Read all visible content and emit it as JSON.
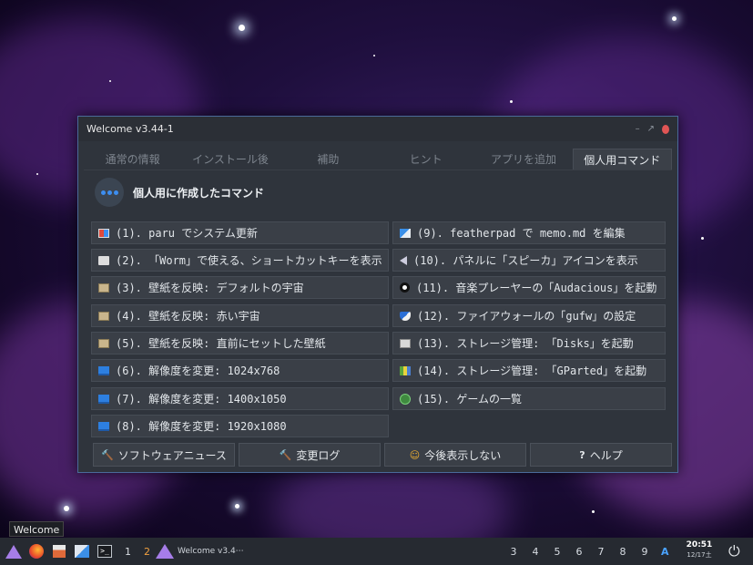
{
  "window": {
    "title": "Welcome v3.44-1",
    "controls": {
      "minimize": "–",
      "maximize": "↗"
    }
  },
  "tabs": [
    {
      "label": "通常の情報"
    },
    {
      "label": "インストール後"
    },
    {
      "label": "補助"
    },
    {
      "label": "ヒント"
    },
    {
      "label": "アプリを追加"
    },
    {
      "label": "個人用コマンド",
      "active": true
    }
  ],
  "header": {
    "title": "個人用に作成したコマンド",
    "icon": "dots-icon"
  },
  "commands_left": [
    {
      "label": "(1). paru でシステム更新",
      "icon": "grid-icon"
    },
    {
      "label": "(2). 「Worm」で使える、ショートカットキーを表示",
      "icon": "keyboard-icon"
    },
    {
      "label": "(3). 壁紙を反映: デフォルトの宇宙",
      "icon": "wallpaper-icon"
    },
    {
      "label": "(4). 壁紙を反映: 赤い宇宙",
      "icon": "wallpaper-icon"
    },
    {
      "label": "(5). 壁紙を反映: 直前にセットした壁紙",
      "icon": "wallpaper-icon"
    },
    {
      "label": "(6). 解像度を変更: 1024x768",
      "icon": "monitor-icon"
    },
    {
      "label": "(7). 解像度を変更: 1400x1050",
      "icon": "monitor-icon"
    },
    {
      "label": "(8). 解像度を変更: 1920x1080",
      "icon": "monitor-icon"
    }
  ],
  "commands_right": [
    {
      "label": "(9). featherpad で memo.md を編集",
      "icon": "edit-icon"
    },
    {
      "label": "(10). パネルに「スピーカ」アイコンを表示",
      "icon": "speaker-icon"
    },
    {
      "label": "(11). 音楽プレーヤーの「Audacious」を起動",
      "icon": "audio-icon"
    },
    {
      "label": "(12). ファイアウォールの「gufw」の設定",
      "icon": "shield-icon"
    },
    {
      "label": "(13). ストレージ管理: 「Disks」を起動",
      "icon": "disk-icon"
    },
    {
      "label": "(14). ストレージ管理: 「GParted」を起動",
      "icon": "gparted-icon"
    },
    {
      "label": "(15). ゲームの一覧",
      "icon": "game-icon"
    }
  ],
  "bottom_buttons": [
    {
      "label": "ソフトウェアニュース",
      "icon": "hammer-icon",
      "glyph": "🔨"
    },
    {
      "label": "変更ログ",
      "icon": "hammer-icon",
      "glyph": "🔨"
    },
    {
      "label": "今後表示しない",
      "icon": "smile-icon",
      "glyph": "☺"
    },
    {
      "label": "ヘルプ",
      "icon": "help-icon",
      "glyph": "?"
    }
  ],
  "tooltip": "Welcome",
  "taskbar": {
    "workspace_1": "1",
    "workspace_2": "2",
    "task_label": "Welcome v3.4⋯",
    "workspaces_right": [
      "3",
      "4",
      "5",
      "6",
      "7",
      "8",
      "9"
    ],
    "keyboard_indicator": "A",
    "clock_time": "20:51",
    "clock_date": "12/17土"
  },
  "colors": {
    "accent": "#3d8ef0",
    "window_bg": "#2f343c",
    "button_bg": "#3a3f47"
  }
}
